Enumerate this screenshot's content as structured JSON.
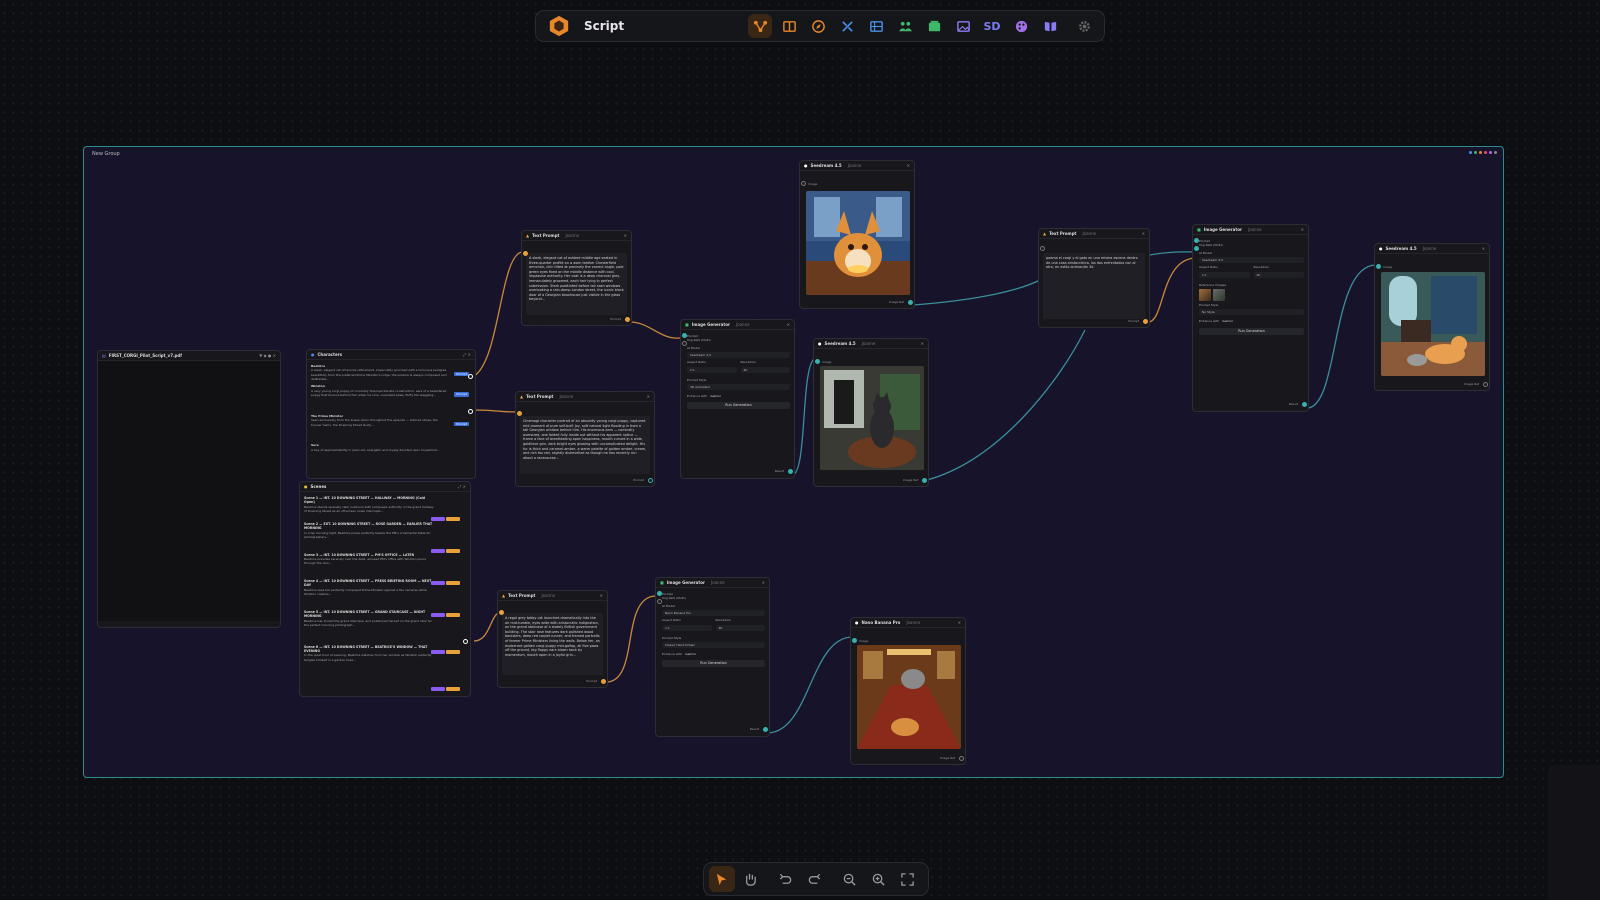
{
  "app": {
    "title": "Script"
  },
  "toolbar": {
    "tools": [
      {
        "name": "workflow",
        "icon": "workflow-icon",
        "active": true
      },
      {
        "name": "layout",
        "icon": "layout-icon"
      },
      {
        "name": "compass",
        "icon": "compass-icon"
      },
      {
        "name": "tools",
        "icon": "tools-icon"
      },
      {
        "name": "storyboard",
        "icon": "storyboard-icon"
      },
      {
        "name": "characters",
        "icon": "people-icon"
      },
      {
        "name": "scenes",
        "icon": "scenes-icon"
      },
      {
        "name": "gallery",
        "icon": "image-gallery-icon"
      },
      {
        "name": "sd",
        "label": "SD"
      },
      {
        "name": "palette",
        "icon": "palette-icon"
      },
      {
        "name": "library",
        "icon": "book-icon"
      },
      {
        "name": "settings",
        "icon": "gear-icon"
      }
    ]
  },
  "group": {
    "title": "New Group"
  },
  "nodes": {
    "pdf": {
      "title": "FIRST_CORGI_Pilot_Script_v7.pdf"
    },
    "characters": {
      "title": "Characters",
      "items": [
        {
          "name": "Beatrice",
          "text": "A sleek, elegant cat of leonine refinement, impeccably groomed with a luminous pedigree beautifully from the preferred Prime Minister's lodge, the posture is always composed and deliberate..."
        },
        {
          "name": "Winston",
          "text": "A very young corgi puppy of comically disproportionate construction, ears of a bewildered puppy that bounce behind him when he runs, oversized paws, fluffy tail waggling..."
        },
        {
          "name": "The Prime Minister",
          "text": "Seen exclusively from the knees down throughout the episode — tailored shoes, the trouser hems, the Downing Street study..."
        },
        {
          "name": "Vera",
          "text": "A bay of approachability in plain old, energetic and loyally devoted upon household..."
        }
      ],
      "button": "Prompt"
    },
    "scenes": {
      "title": "Scenes",
      "items": [
        {
          "title": "Scene 1 — INT. 10 DOWNING STREET — HALLWAY — MORNING (Cold Open)",
          "text": "Beatrice stands serenely calm outdoors with composed authority in the grand hallway of Downing Street as an off-screen noise interrupts..."
        },
        {
          "title": "Scene 2 — EXT. 10 DOWNING STREET — ROSE GARDEN — EARLIER THAT MORNING",
          "text": "In crisp morning light, Beatrice poses perfectly beside the PM's ornamental table for photographers..."
        },
        {
          "title": "Scene 3 — INT. 10 DOWNING STREET — PM'S OFFICE — LATER",
          "text": "Beatrice presides serenely over the desk, amused PM's office with Winston pours through the door..."
        },
        {
          "title": "Scene 4 — INT. 10 DOWNING STREET — PRESS BRIEFING ROOM — NEXT DAY",
          "text": "Beatrice sees her perfectly composed Prime Minister against a the cameras while Winston crashes..."
        },
        {
          "title": "Scene 5 — INT. 10 DOWNING STREET — GRAND STAIRCASE — NIGHT MORNING",
          "text": "Beatrice has toured the grand staircase, and positioned herself on the grand stair for the perfect morning photograph..."
        },
        {
          "title": "Scene 6 — INT. 10 DOWNING STREET — BEATRICE'S WINDOW — THAT EVENING",
          "text": "In the quiet hour of evening, Beatrice watches from her window as Winston perfectly tangles himself in a garden hose..."
        }
      ],
      "tagA": "Shortlist",
      "tagB": "Prompt"
    },
    "tp1": {
      "title": "Text Prompt",
      "sub": "Joanne",
      "text": "A sleek, elegant cat of ashbed middle age seated in three-quarter profile on a worn leather Chesterfield armchair, chin tilted at precisely the correct angle, pale green eyes fixed on the middle distance with cool, impassive authority. Her coat is a deep charcoal grey, immaculately groomed, each hair lying in perfect submission. Stark pooltinted before tall sash windows overlooking a rain-damp London street, the iconic black door of a Georgian townhouse just visible in the glass beyond...",
      "port": "Prompt"
    },
    "tp2": {
      "title": "Text Prompt",
      "sub": "Joanne",
      "text": "Cinemagi character portrait of an absurdly young corgi puppy, captured mid-moment of pure self-built joy, soft natural light flooding in from a tall Georgian window behind him. His enormous ears — comically oversized, one folded fully inside out without his apparent notice — frame a face of breathtaking open happiness, mouth curved in a wide, goldilove grin, dark bright eyes glowing with uncomplicated delight. His fur is thick and caramel-amber, a warm palette of golden amber, cream, and rich fox red, slightly dishevelled as though he has recently run about a racecourse...",
      "port": "Prompt"
    },
    "tp3": {
      "title": "Text Prompt",
      "sub": "Joanne",
      "text": "A regal grey tabby cat launched dramatically into the air mid-tumble, eyes wide with aristocratic indignation, on the grand staircase of a stately British government building. The stair rose features dark polished wood banisters, deep red carpet runner, and framed portraits of former Prime Ministers lining the walls. Below her, an exuberant golden corgi puppy mid-gallop, all five paws off the ground, big floppy ears blown back by momentum, mouth open in a joyful grin...",
      "port": "Prompt"
    },
    "tp4": {
      "title": "Text Prompt",
      "sub": "Joanne",
      "text": "poema el corgi y el gato en una misma escena dentro de una casa aristocrática. los dos enfrentados con al otro, en estilo animación 3d",
      "port": "Prompt"
    },
    "ig1": {
      "title": "Image Generator",
      "sub": "Joanne",
      "p1": "Prompt",
      "p2": "Img Refs (Multi)",
      "model_label": "AI Model",
      "model": "Seedream 4.5",
      "ar_label": "Aspect Ratio",
      "ar": "1:1",
      "res_label": "Resolution",
      "res": "2K",
      "style_label": "Prompt Style",
      "style": "3D Animated",
      "enh": "Enhance with",
      "enh_model": "Gemini",
      "run": "Run Generation",
      "out": "Result"
    },
    "ig2": {
      "title": "Image Generator",
      "sub": "Joanne",
      "p1": "Prompt",
      "p2": "Img Refs (Multi)",
      "model_label": "AI Model",
      "model": "Nano Banana Pro",
      "ar_label": "Aspect Ratio",
      "ar": "1:1",
      "res_label": "Resolution",
      "res": "2K",
      "style_label": "Prompt Style",
      "style": "Classic Hand-Drawn",
      "enh": "Enhance with",
      "enh_model": "Gemini",
      "run": "Run Generation",
      "out": "Result"
    },
    "ig3": {
      "title": "Image Generator",
      "sub": "Joanne",
      "p1": "Prompt",
      "p2": "Img Refs (Multi)",
      "model_label": "AI Model",
      "model": "Seedream 4.5",
      "ar_label": "Aspect Ratio",
      "ar": "1:1",
      "res_label": "Resolution",
      "res": "2K",
      "refs_label": "Reference Images",
      "style_label": "Prompt Style",
      "style": "No Style",
      "enh": "Enhance with",
      "enh_model": "Gemini",
      "run": "Run Generation",
      "out": "Result"
    },
    "sd1": {
      "title": "Seedream 4.5",
      "sub": "Joanne",
      "in": "Image",
      "out": "Image Ref"
    },
    "sd2": {
      "title": "Seedream 4.5",
      "sub": "Joanne",
      "in": "Image",
      "out": "Image Ref"
    },
    "sd3": {
      "title": "Seedream 4.5",
      "sub": "Joanne",
      "in": "Image",
      "out": "Image Ref"
    },
    "nb1": {
      "title": "Nano Banana Pro",
      "sub": "Joanne",
      "in": "Image",
      "out": "Image Ref"
    }
  },
  "bottom": {
    "tools": [
      "select-tool",
      "hand-tool",
      "undo",
      "redo",
      "zoom-out",
      "zoom-in",
      "fit-screen"
    ]
  },
  "colors": {
    "accent": "#e8872a",
    "wire_orange": "#c88a3a",
    "wire_teal": "#3a8f98",
    "group_border": "#2c8c8c"
  }
}
